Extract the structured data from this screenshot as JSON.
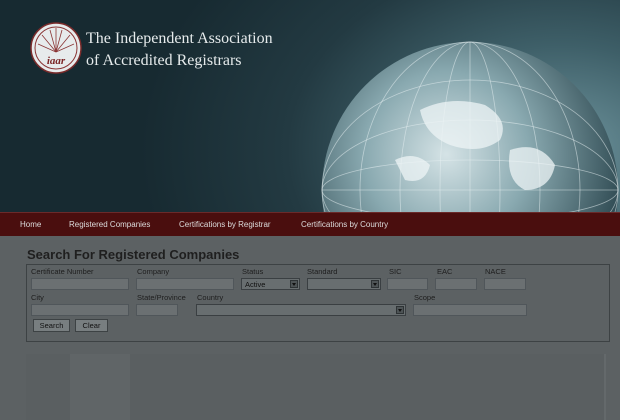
{
  "header": {
    "title_line1": "The Independent Association",
    "title_line2": "of Accredited Registrars",
    "logo_text": "iaar"
  },
  "nav": {
    "items": [
      {
        "label": "Home"
      },
      {
        "label": "Registered Companies"
      },
      {
        "label": "Certifications by Registrar"
      },
      {
        "label": "Certifications by Country"
      }
    ]
  },
  "search": {
    "heading": "Search For Registered Companies",
    "labels": {
      "certificate_number": "Certificate Number",
      "company": "Company",
      "status": "Status",
      "standard": "Standard",
      "sic": "SIC",
      "eac": "EAC",
      "nace": "NACE",
      "city": "City",
      "state": "State/Province",
      "country": "Country",
      "scope": "Scope"
    },
    "values": {
      "certificate_number": "",
      "company": "",
      "status": "Active",
      "standard": "",
      "sic": "",
      "eac": "",
      "nace": "",
      "city": "",
      "state": "",
      "country": "",
      "scope": ""
    },
    "buttons": {
      "search": "Search",
      "clear": "Clear"
    }
  },
  "colors": {
    "nav_background": "#4a0e0e",
    "header_dark": "#172a31",
    "content_background": "#5c6163"
  }
}
